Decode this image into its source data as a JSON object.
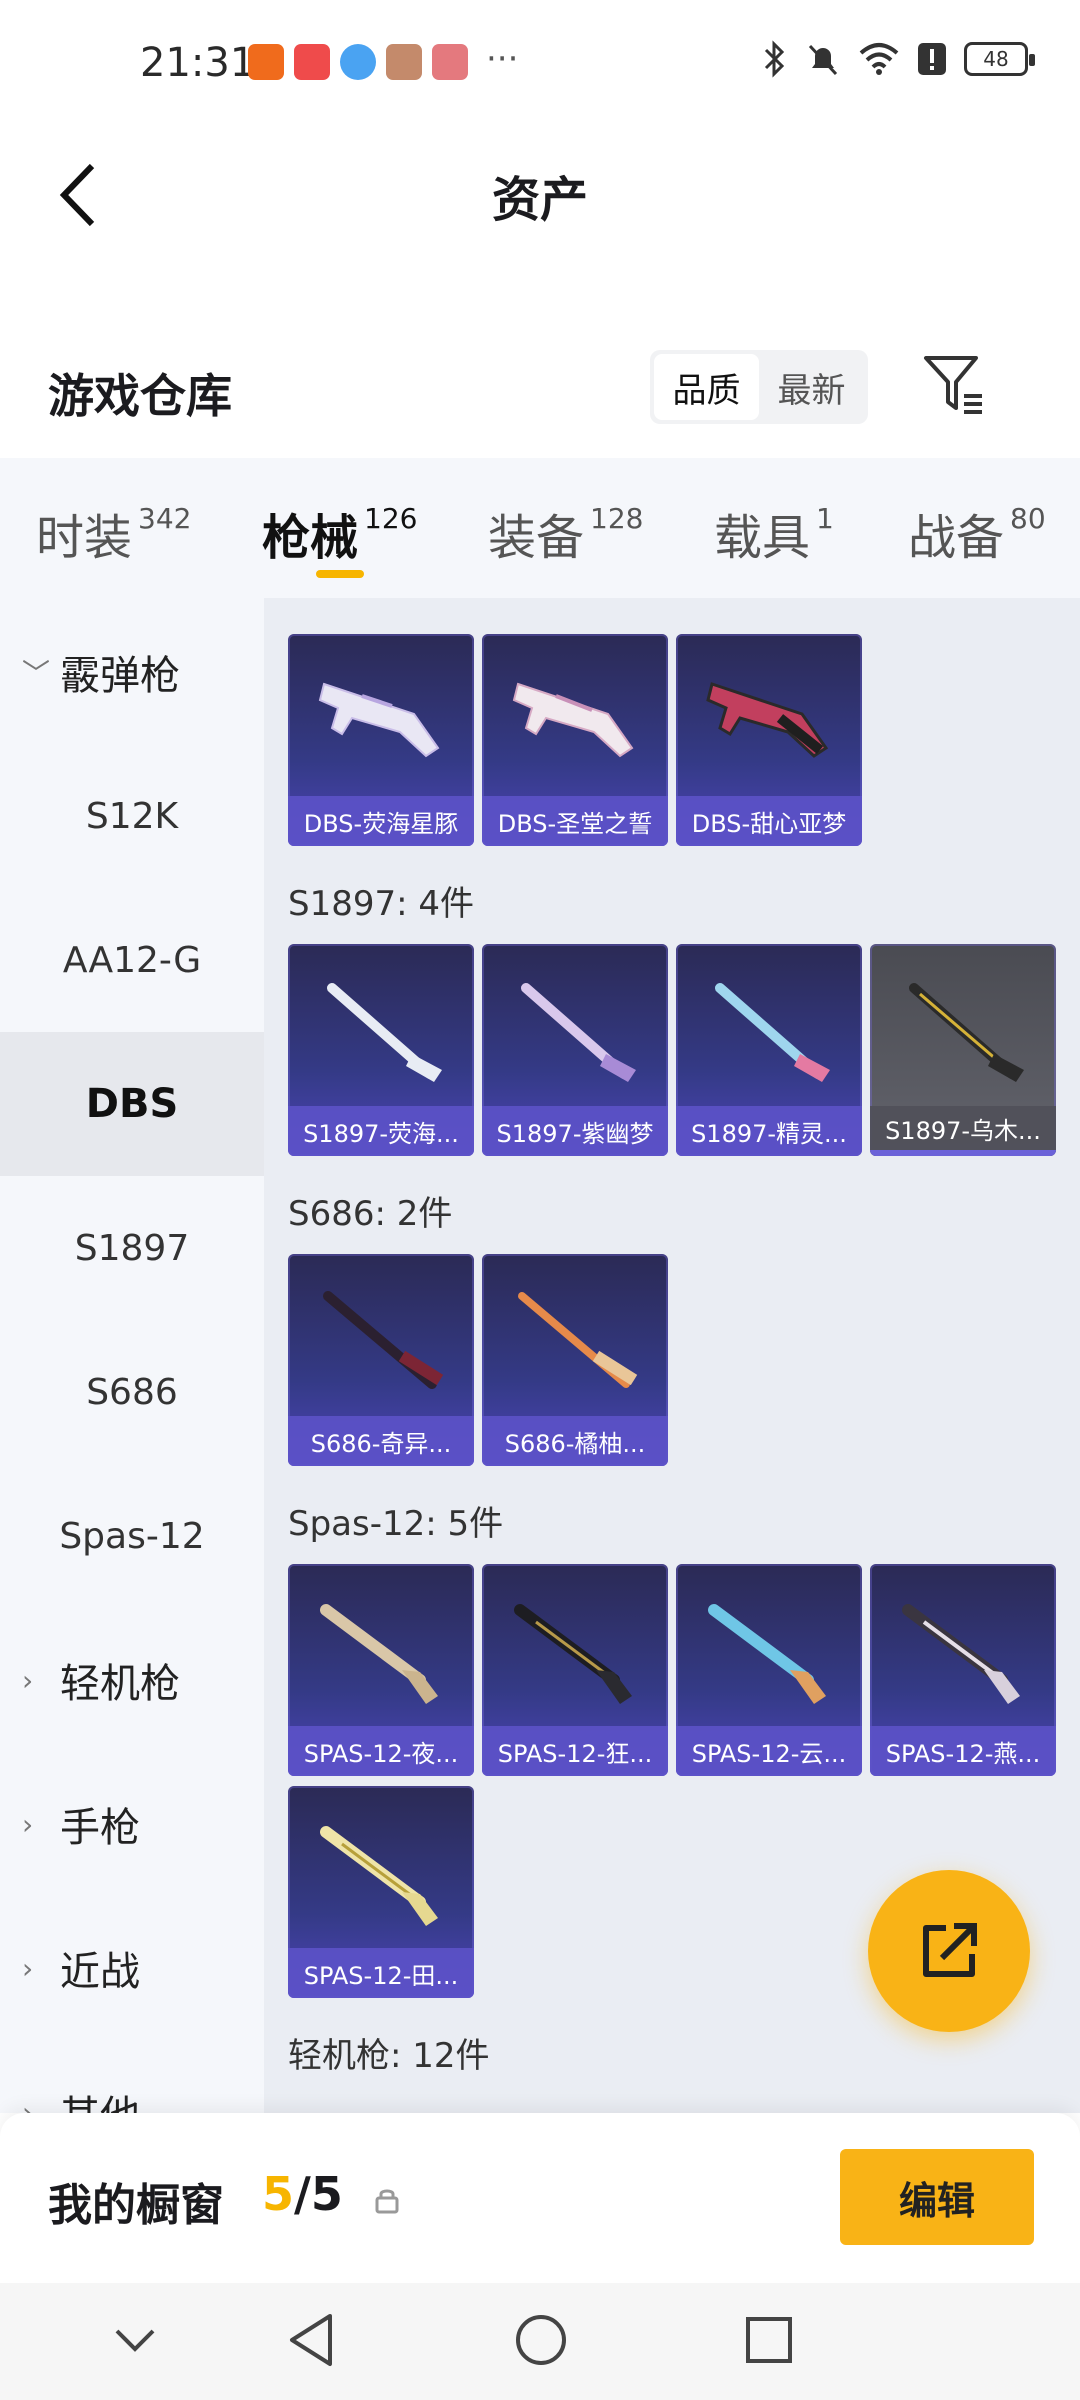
{
  "status_bar": {
    "time": "21:31",
    "more_notifications": "···",
    "battery_level": "48",
    "notification_icon_colors": [
      "#f06b1c",
      "#ef4b4b",
      "#4aa3f2",
      "#c48a6b",
      "#e4797e"
    ]
  },
  "header": {
    "title": "资产",
    "back_icon": "chevron-left-icon"
  },
  "warehouse": {
    "title": "游戏仓库",
    "sort_options": [
      "品质",
      "最新"
    ],
    "active_sort": "品质",
    "filter_icon": "filter-icon"
  },
  "tabs": [
    {
      "label": "时装",
      "count": "342"
    },
    {
      "label": "枪械",
      "count": "126",
      "active": true
    },
    {
      "label": "装备",
      "count": "128"
    },
    {
      "label": "载具",
      "count": "1"
    },
    {
      "label": "战备",
      "count": "80"
    }
  ],
  "left_nav": [
    {
      "label": "霰弹枪",
      "type": "group",
      "expanded": true
    },
    {
      "label": "S12K",
      "type": "item"
    },
    {
      "label": "AA12-G",
      "type": "item"
    },
    {
      "label": "DBS",
      "type": "item",
      "active": true
    },
    {
      "label": "S1897",
      "type": "item"
    },
    {
      "label": "S686",
      "type": "item"
    },
    {
      "label": "Spas-12",
      "type": "item"
    },
    {
      "label": "轻机枪",
      "type": "group"
    },
    {
      "label": "手枪",
      "type": "group"
    },
    {
      "label": "近战",
      "type": "group"
    },
    {
      "label": "其他",
      "type": "group"
    }
  ],
  "sections": [
    {
      "label": "",
      "items": [
        "DBS-荧海星豚",
        "DBS-圣堂之誓",
        "DBS-甜心亚梦"
      ]
    },
    {
      "label": "S1897: 4件",
      "items": [
        "S1897-荧海...",
        "S1897-紫幽梦",
        "S1897-精灵...",
        "S1897-乌木..."
      ]
    },
    {
      "label": "S686: 2件",
      "items": [
        "S686-奇异...",
        "S686-橘柚..."
      ]
    },
    {
      "label": "Spas-12: 5件",
      "items": [
        "SPAS-12-夜...",
        "SPAS-12-狂...",
        "SPAS-12-云...",
        "SPAS-12-燕...",
        "SPAS-12-田..."
      ]
    },
    {
      "label": "轻机枪: 12件",
      "items": []
    }
  ],
  "showcase": {
    "title": "我的橱窗",
    "current": "5",
    "separator": "/",
    "total": "5",
    "edit_label": "编辑"
  },
  "colors": {
    "accent": "#f9b316",
    "card_purple": "#3d3c92",
    "name_bar": "#5c52c8"
  }
}
